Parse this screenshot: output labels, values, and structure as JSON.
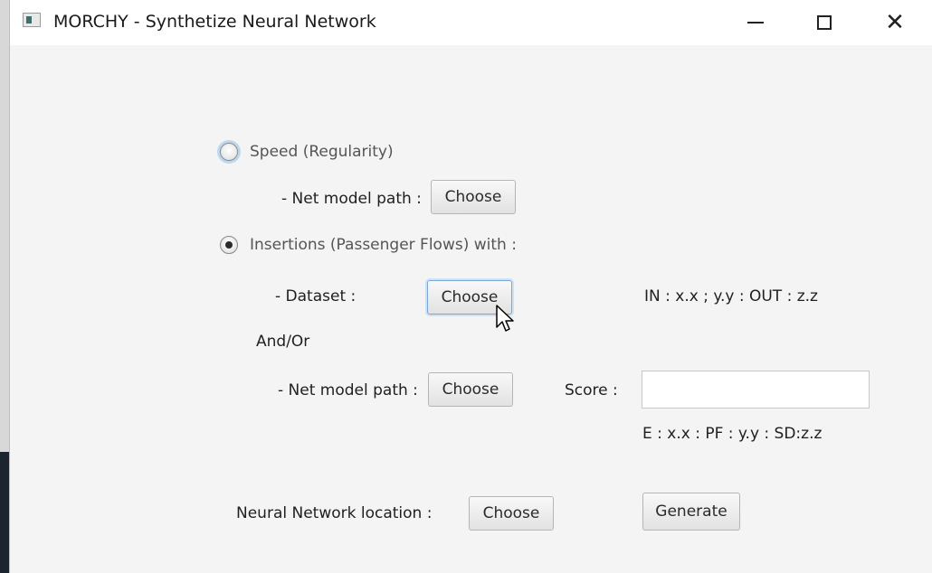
{
  "window": {
    "title": "MORCHY - Synthetize Neural Network",
    "controls": {
      "minimize": "minimize-icon",
      "maximize": "maximize-icon",
      "close": "close-icon"
    }
  },
  "form": {
    "speed_option": {
      "label": "Speed (Regularity)",
      "selected": false
    },
    "speed_net_model": {
      "label": "- Net model path :",
      "button": "Choose"
    },
    "insertions_option": {
      "label": "Insertions (Passenger Flows) with :",
      "selected": true
    },
    "dataset": {
      "label": "- Dataset :",
      "button": "Choose",
      "info": "IN : x.x ; y.y : OUT : z.z"
    },
    "and_or": "And/Or",
    "insertions_net_model": {
      "label": "- Net model path :",
      "button": "Choose"
    },
    "score": {
      "label": "Score :",
      "value": "",
      "info": "E : x.x : PF : y.y : SD:z.z"
    },
    "nn_location": {
      "label": "Neural Network location :",
      "button": "Choose"
    },
    "generate_button": "Generate"
  }
}
